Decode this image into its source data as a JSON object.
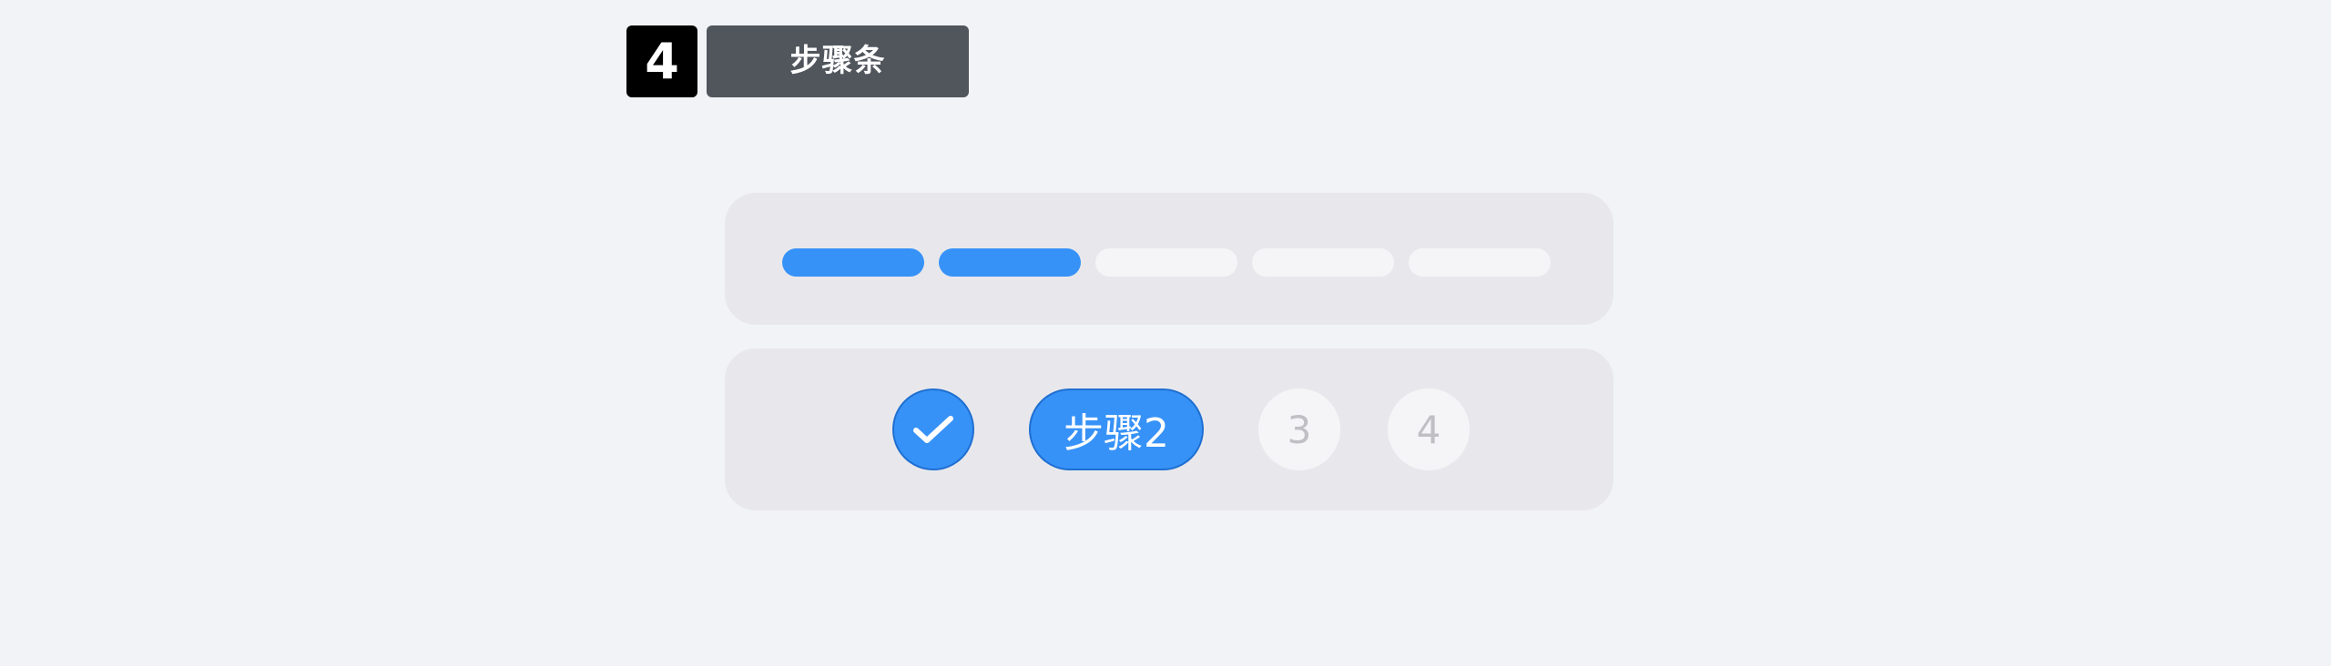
{
  "header": {
    "number": "4",
    "title": "步骤条"
  },
  "progress_bar": {
    "total_segments": 5,
    "completed_segments": 2,
    "active_color": "#3792f7",
    "inactive_color": "#f5f5f7"
  },
  "stepper": {
    "steps": [
      {
        "state": "completed",
        "icon": "check-icon"
      },
      {
        "state": "current",
        "label": "步骤2"
      },
      {
        "state": "pending",
        "label": "3"
      },
      {
        "state": "pending",
        "label": "4"
      }
    ],
    "active_color": "#3792f7"
  }
}
